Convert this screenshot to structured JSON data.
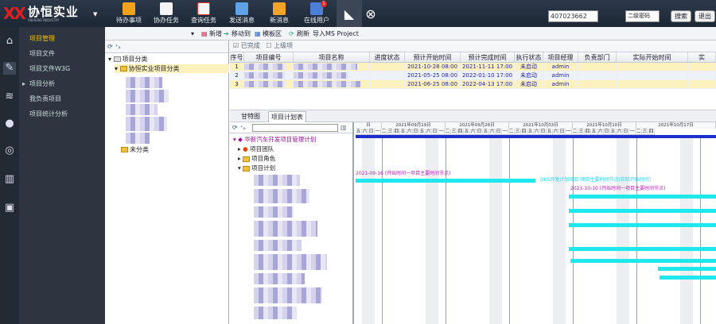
{
  "app": {
    "logo_mark": "XX",
    "logo_name": "协恒实业",
    "logo_en": "XIEHENG INDUSTRY",
    "accent": "#e02020"
  },
  "topnav": [
    {
      "label": "待办事项",
      "icon": "todo-icon"
    },
    {
      "label": "协办任务",
      "icon": "task-icon"
    },
    {
      "label": "查询任务",
      "icon": "search-task-icon"
    },
    {
      "label": "发送消息",
      "icon": "send-message-icon"
    },
    {
      "label": "新消息",
      "icon": "new-message-icon"
    },
    {
      "label": "在线用户",
      "icon": "online-users-icon",
      "badge": "1"
    }
  ],
  "header": {
    "search_value": "407023662",
    "select_value": "二级密码",
    "search_button": "搜索",
    "logout_button": "退出"
  },
  "sidemenu": [
    {
      "label": "项目管理",
      "active": true
    },
    {
      "label": "项目文件"
    },
    {
      "label": "项目文件W3G"
    },
    {
      "label": "项目分析"
    },
    {
      "label": "我负责项目"
    },
    {
      "label": "项目统计分析"
    }
  ],
  "toolbar": {
    "add": "新增",
    "move": "移动到",
    "template": "模板区",
    "refresh": "刷新",
    "import": "导入MS Project"
  },
  "left_tree": {
    "root": "项目分类",
    "child": "协恒实业项目分类",
    "other": "未分类"
  },
  "right_toolbar": {
    "check1": "已完成",
    "check2": "上级项"
  },
  "grid": {
    "columns": [
      "序号",
      "项目编号",
      "项目名称",
      "进度状态",
      "预计开始时间",
      "预计完成时间",
      "执行状态",
      "项目经理",
      "负责部门",
      "实际开始时间",
      "实"
    ],
    "rows": [
      {
        "no": "1",
        "start": "2021-10-28 08:00",
        "end": "2021-11-11 17:00",
        "status": "未启动",
        "manager": "admin"
      },
      {
        "no": "2",
        "start": "2021-05-25 08:00",
        "end": "2022-01-10 17:00",
        "status": "未启动",
        "manager": "admin"
      },
      {
        "no": "3",
        "start": "2021-06-25 08:00",
        "end": "2022-04-13 17:00",
        "status": "未启动",
        "manager": "admin"
      }
    ]
  },
  "tabs": [
    "甘特图",
    "项目计划表"
  ],
  "gantt_tree": {
    "project": "华新汽车开发项目管理计划",
    "item1": "项目团队",
    "item2": "项目角色",
    "item3": "项目计划"
  },
  "gantt": {
    "dates": [
      "2021年09月19日",
      "2021年09月26日",
      "2021年10月03日",
      "2021年10月10日",
      "2021年10月17日"
    ],
    "weekdays": [
      "五",
      "六",
      "日",
      "一",
      "二",
      "三",
      "四",
      "五",
      "六",
      "日"
    ],
    "label1": "2021-09-16 (开始时间一项目主要时间节点)",
    "label2": "DKS开发计划项目-项目主要时间节点(实际开始时间)",
    "label3": "2021-10-10 (开始时间一项目主要时间节点)",
    "bar_color": "#1ee7ee",
    "milestone_color": "#d020d0"
  }
}
